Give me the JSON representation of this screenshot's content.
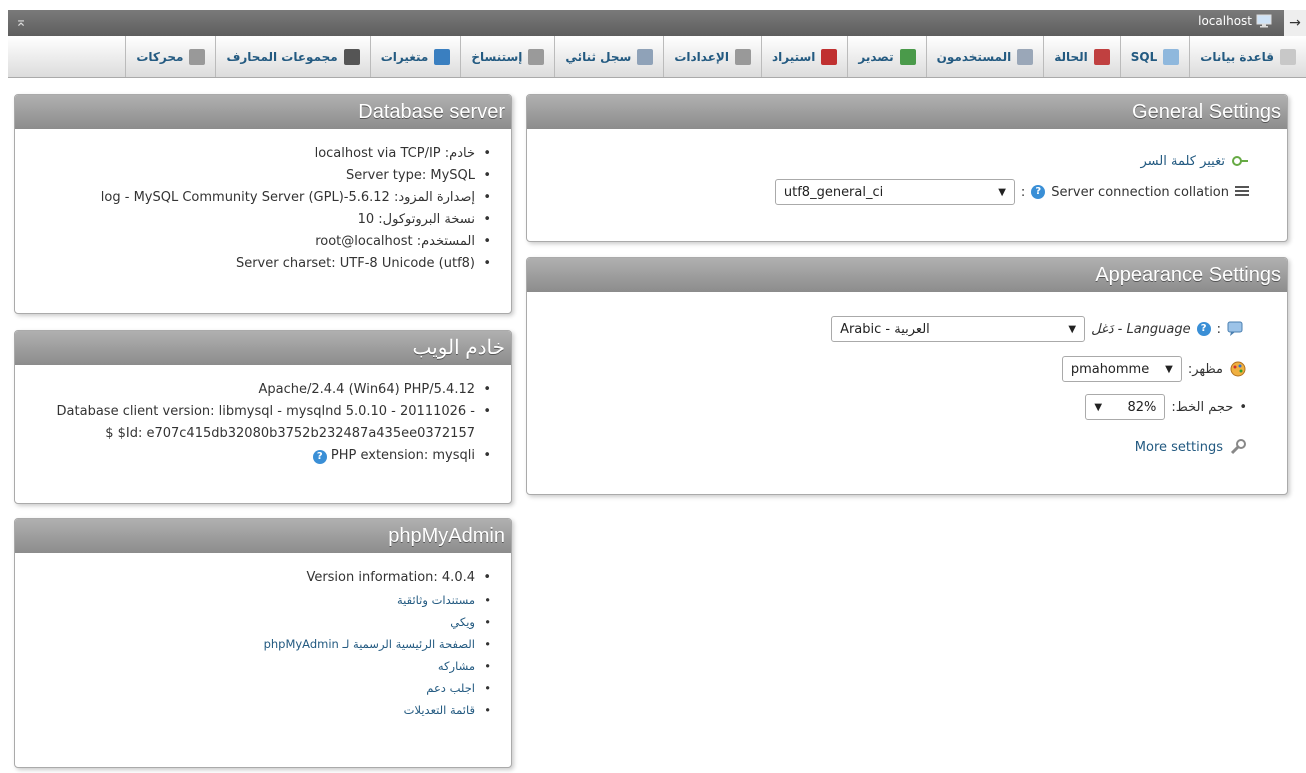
{
  "topbar": {
    "server": "localhost",
    "arrow": "→",
    "collapse": "⌅"
  },
  "menu": [
    {
      "label": "قاعدة بيانات",
      "icon": "database-icon",
      "color": "#c8c8c8"
    },
    {
      "label": "SQL",
      "icon": "sql-icon",
      "color": "#8fb8dd"
    },
    {
      "label": "الحالة",
      "icon": "status-icon",
      "color": "#c04040"
    },
    {
      "label": "المستخدمون",
      "icon": "users-icon",
      "color": "#9aa7b8"
    },
    {
      "label": "تصدير",
      "icon": "export-icon",
      "color": "#4a9a4a"
    },
    {
      "label": "استيراد",
      "icon": "import-icon",
      "color": "#c03030"
    },
    {
      "label": "الإعدادات",
      "icon": "settings-icon",
      "color": "#999999"
    },
    {
      "label": "سجل ثنائي",
      "icon": "binlog-icon",
      "color": "#8fa2b8"
    },
    {
      "label": "إستنساخ",
      "icon": "replication-icon",
      "color": "#9a9a9a"
    },
    {
      "label": "متغيرات",
      "icon": "variables-icon",
      "color": "#3a7fc0"
    },
    {
      "label": "مجموعات المحارف",
      "icon": "charsets-icon",
      "color": "#555555"
    },
    {
      "label": "محركات",
      "icon": "engines-icon",
      "color": "#999999"
    }
  ],
  "db_server": {
    "title": "Database server",
    "items": [
      "خادم: localhost via TCP/IP",
      "Server type: MySQL",
      "إصدارة المزود: 5.6.12-log - MySQL Community Server (GPL)",
      "نسخة البروتوكول: 10",
      "المستخدم: root@localhost",
      "Server charset: UTF-8 Unicode (utf8)"
    ]
  },
  "web_server": {
    "title": "خادم الويب",
    "items": [
      "Apache/2.4.4 (Win64) PHP/5.4.12",
      "Database client version: libmysql - mysqlnd 5.0.10 - 20111026 - $Id: e707c415db32080b3752b232487a435ee0372157 $",
      "PHP extension: mysqli"
    ]
  },
  "pma": {
    "title": "phpMyAdmin",
    "version": "Version information: 4.0.4",
    "links": [
      "مستندات وثائقية",
      "ويكي",
      "الصفحة الرئيسية الرسمية لـ phpMyAdmin",
      "مشاركه",
      "اجلب دعم",
      "قائمة التعديلات"
    ]
  },
  "general": {
    "title": "General Settings",
    "change_password": "تغيير كلمة السر",
    "collation_label": "Server connection collation",
    "collation_value": "utf8_general_ci"
  },
  "appearance": {
    "title": "Appearance Settings",
    "language_label": "Language - دَغل",
    "language_value": "Arabic - العربية",
    "theme_label": "مظهر:",
    "theme_value": "pmahomme",
    "font_label": "حجم الخط:",
    "font_value": "82%",
    "more_settings": "More settings"
  }
}
